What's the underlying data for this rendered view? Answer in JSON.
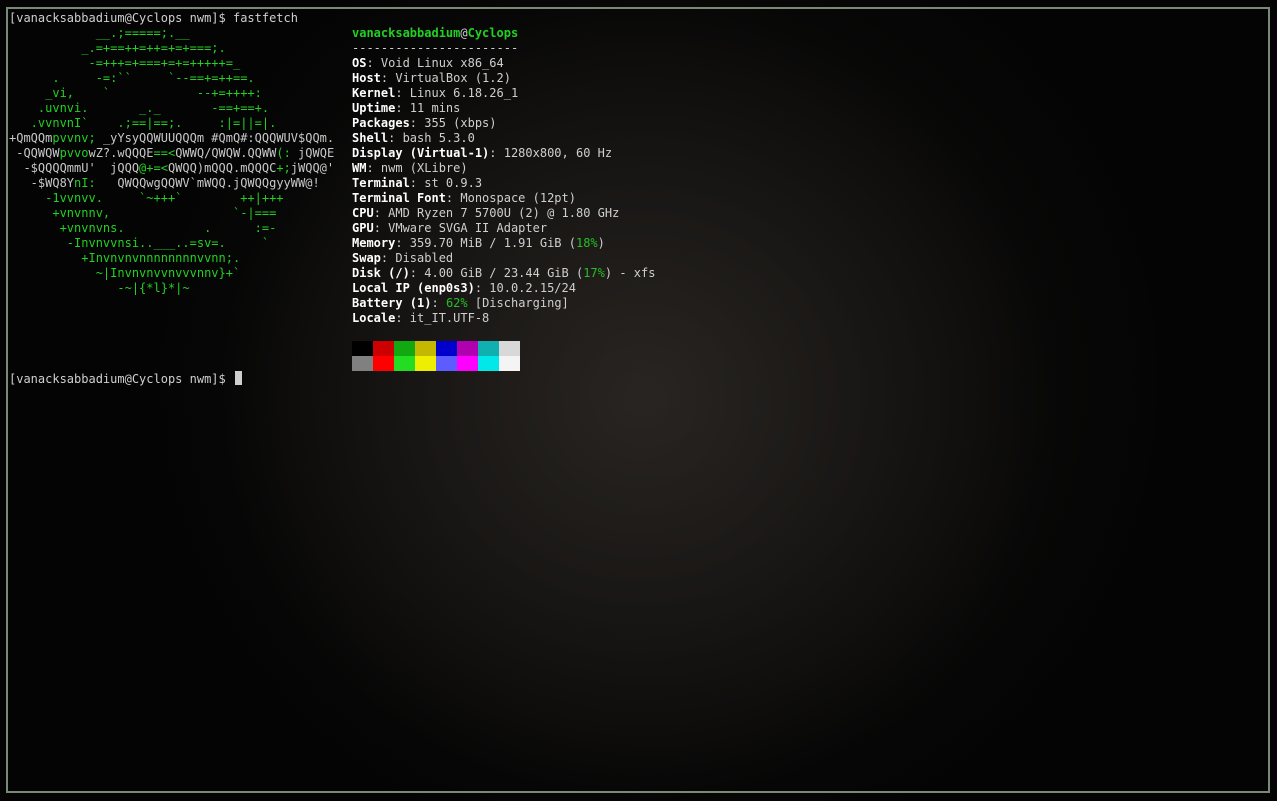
{
  "terminal": {
    "prompt1": "[vanacksabbadium@Cyclops nwm]$ fastfetch",
    "prompt2": "[vanacksabbadium@Cyclops nwm]$ "
  },
  "logo": [
    [
      [
        "g",
        "            __.;=====;.__"
      ]
    ],
    [
      [
        "g",
        "          _.=+==++=++=+=+===;."
      ]
    ],
    [
      [
        "g",
        "           -=+++=+===+=+=+++++=_"
      ]
    ],
    [
      [
        "g",
        "      .     -=:``     `--==+=++==."
      ]
    ],
    [
      [
        "g",
        "     _vi,    `            --+=++++:"
      ]
    ],
    [
      [
        "g",
        "    .uvnvi.       _._       -==+==+."
      ]
    ],
    [
      [
        "g",
        "   .vvnvnI`    .;==|==;.     :|=||=|."
      ]
    ],
    [
      [
        "w",
        "+QmQQm"
      ],
      [
        "g",
        "pvvnv; "
      ],
      [
        "w",
        "_yYsyQQWUUQQQm #QmQ#:QQQWUV$QQm."
      ]
    ],
    [
      [
        "w",
        " -QQWQW"
      ],
      [
        "g",
        "pvvo"
      ],
      [
        "w",
        "wZ?.wQQQE"
      ],
      [
        "g",
        "==<"
      ],
      [
        "w",
        "QWWQ/QWQW.QQWW"
      ],
      [
        "g",
        "(: "
      ],
      [
        "w",
        "jQWQE"
      ]
    ],
    [
      [
        "w",
        "  -$QQQQmmU'  jQQQ"
      ],
      [
        "g",
        "@+=<"
      ],
      [
        "w",
        "QWQQ)mQQQ.mQQQC"
      ],
      [
        "g",
        "+;"
      ],
      [
        "w",
        "jWQQ@'"
      ]
    ],
    [
      [
        "w",
        "   -$WQ8Y"
      ],
      [
        "g",
        "nI:   "
      ],
      [
        "w",
        "QWQQwgQQWV`mWQQ.jQWQQgyyWW@!"
      ]
    ],
    [
      [
        "g",
        "     -1vvnvv.     `~+++`        ++|+++"
      ]
    ],
    [
      [
        "g",
        "      +vnvnnv,                 `-|==="
      ]
    ],
    [
      [
        "g",
        "       +vnvnvns.           .      :=-"
      ]
    ],
    [
      [
        "g",
        "        -Invnvvnsi..___..=sv=.     `"
      ]
    ],
    [
      [
        "g",
        "          +Invnvnvnnnnnnnnvvnn;."
      ]
    ],
    [
      [
        "g",
        "            ~|Invnvnvvnvvvnnv}+`"
      ]
    ],
    [
      [
        "g",
        "               -~|{*l}*|~"
      ]
    ]
  ],
  "info": {
    "user": "vanacksabbadium",
    "at": "@",
    "host": "Cyclops",
    "separator": "-----------------------",
    "rows": [
      {
        "label": "OS",
        "value": ": Void Linux x86_64"
      },
      {
        "label": "Host",
        "value": ": VirtualBox (1.2)"
      },
      {
        "label": "Kernel",
        "value": ": Linux 6.18.26_1"
      },
      {
        "label": "Uptime",
        "value": ": 11 mins"
      },
      {
        "label": "Packages",
        "value": ": 355 (xbps)"
      },
      {
        "label": "Shell",
        "value": ": bash 5.3.0"
      },
      {
        "label": "Display (Virtual-1)",
        "value": ": 1280x800, 60 Hz"
      },
      {
        "label": "WM",
        "value": ": nwm (XLibre)"
      },
      {
        "label": "Terminal",
        "value": ": st 0.9.3"
      },
      {
        "label": "Terminal Font",
        "value": ": Monospace (12pt)"
      },
      {
        "label": "CPU",
        "value": ": AMD Ryzen 7 5700U (2) @ 1.80 GHz"
      },
      {
        "label": "GPU",
        "value": ": VMware SVGA II Adapter"
      },
      {
        "label": "Memory",
        "value": ": 359.70 MiB / 1.91 GiB (",
        "pct": "18%",
        "tail": ")"
      },
      {
        "label": "Swap",
        "value": ": Disabled"
      },
      {
        "label": "Disk (/)",
        "value": ": 4.00 GiB / 23.44 GiB (",
        "pct": "17%",
        "tail": ") - xfs"
      },
      {
        "label": "Local IP (enp0s3)",
        "value": ": 10.0.2.15/24"
      },
      {
        "label": "Battery (1)",
        "value": ": ",
        "pct": "62%",
        "tail": " [Discharging]"
      },
      {
        "label": "Locale",
        "value": ": it_IT.UTF-8"
      }
    ]
  },
  "palette": {
    "normal": [
      "#000000",
      "#cc0000",
      "#12a812",
      "#c4b800",
      "#0000cc",
      "#b000b0",
      "#10b0b0",
      "#d8d8d8"
    ],
    "bright": [
      "#808080",
      "#ff0000",
      "#22dd22",
      "#eeee00",
      "#5c5cff",
      "#ff00ff",
      "#00e8e8",
      "#f4f4f4"
    ]
  }
}
